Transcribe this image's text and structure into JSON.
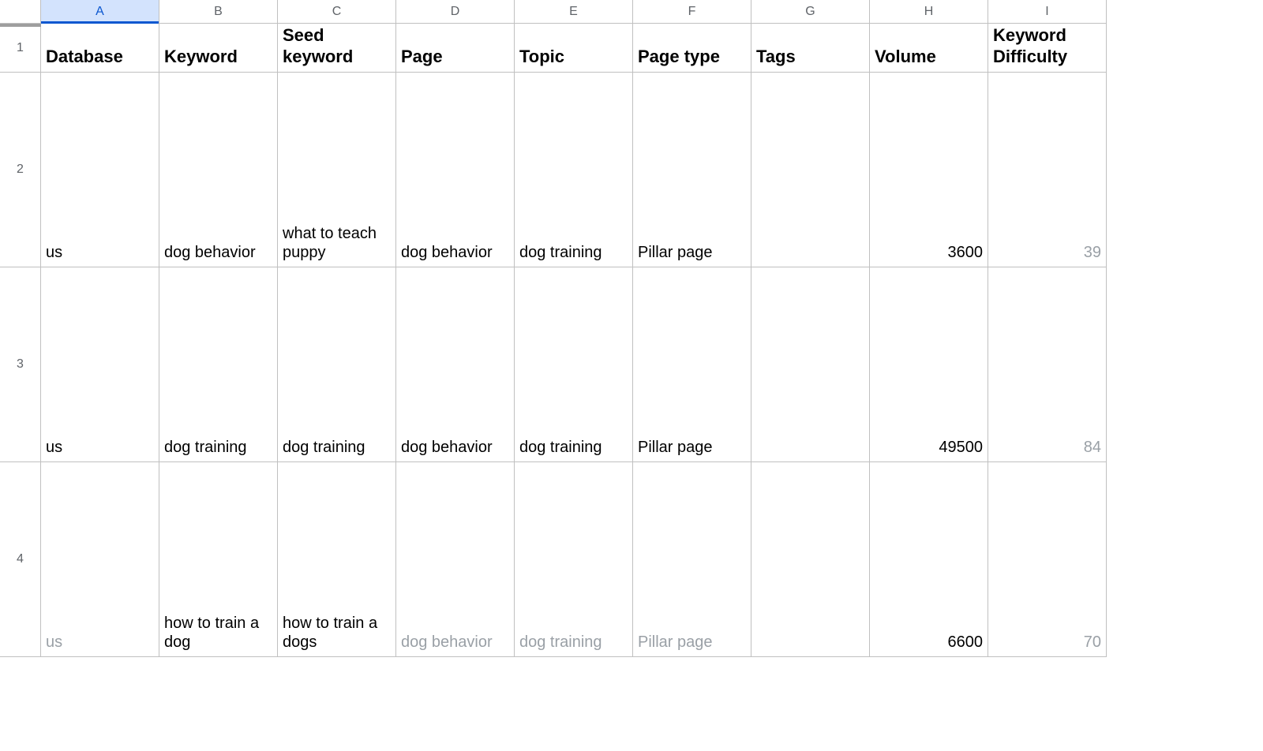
{
  "columns": [
    "A",
    "B",
    "C",
    "D",
    "E",
    "F",
    "G",
    "H",
    "I"
  ],
  "active_column_index": 0,
  "row_numbers": [
    "1",
    "2",
    "3",
    "4"
  ],
  "headers": {
    "A": "Database",
    "B": "Keyword",
    "C": "Seed keyword",
    "D": "Page",
    "E": "Topic",
    "F": "Page type",
    "G": "Tags",
    "H": "Volume",
    "I": "Keyword Difficulty"
  },
  "rows": [
    {
      "A": "us",
      "B": "dog behavior",
      "C": "what to teach puppy",
      "D": "dog behavior",
      "E": "dog training",
      "F": "Pillar page",
      "G": "",
      "H": "3600",
      "I": "39"
    },
    {
      "A": "us",
      "B": "dog training",
      "C": "dog training",
      "D": "dog behavior",
      "E": "dog training",
      "F": "Pillar page",
      "G": "",
      "H": "49500",
      "I": "84"
    },
    {
      "A": "us",
      "B": "how to train a dog",
      "C": "how to train a dogs",
      "D": "dog behavior",
      "E": "dog training",
      "F": "Pillar page",
      "G": "",
      "H": "6600",
      "I": "70"
    }
  ]
}
